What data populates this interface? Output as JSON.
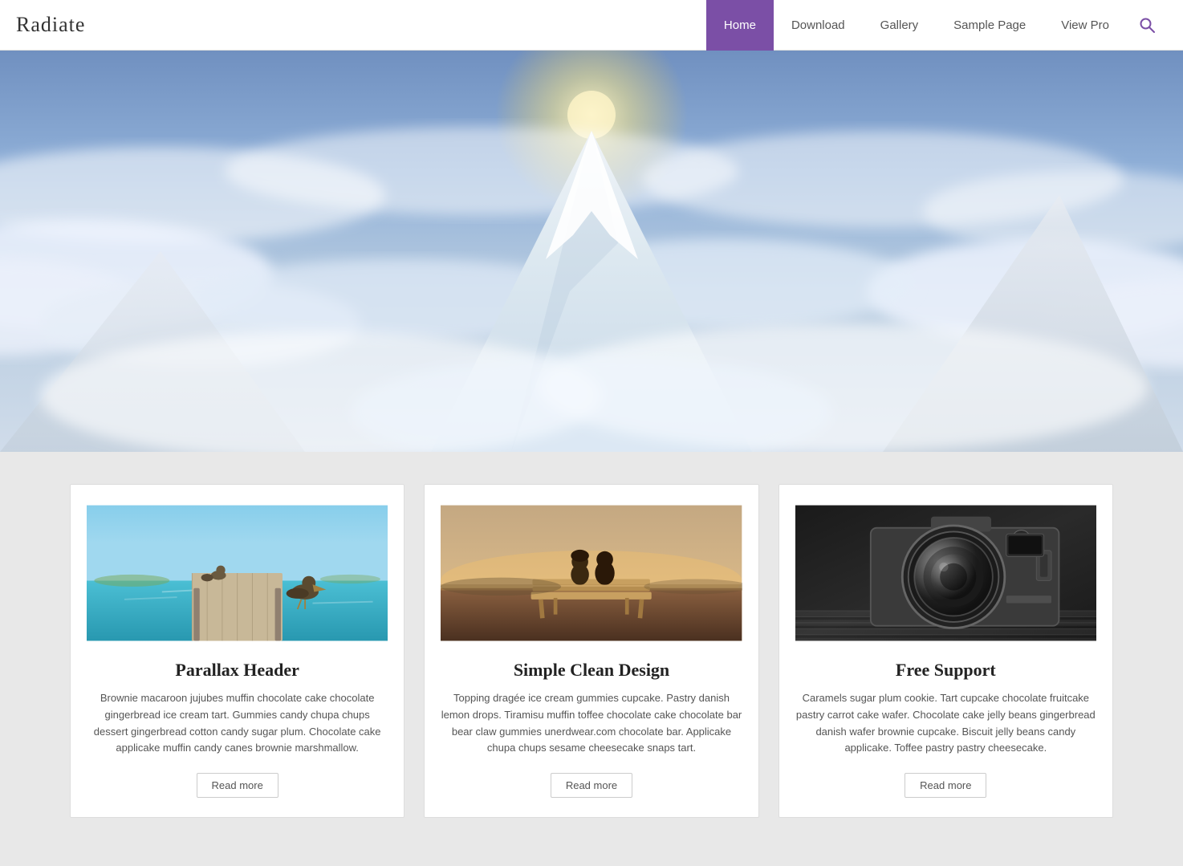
{
  "site": {
    "title": "Radiate"
  },
  "nav": {
    "items": [
      {
        "label": "Home",
        "active": true
      },
      {
        "label": "Download",
        "active": false
      },
      {
        "label": "Gallery",
        "active": false
      },
      {
        "label": "Sample Page",
        "active": false
      },
      {
        "label": "View Pro",
        "active": false
      }
    ]
  },
  "cards": [
    {
      "title": "Parallax Header",
      "text": "Brownie macaroon jujubes muffin chocolate cake chocolate gingerbread ice cream tart. Gummies candy chupa chups dessert gingerbread cotton candy sugar plum. Chocolate cake applicake muffin candy canes brownie marshmallow.",
      "read_more": "Read more",
      "img_type": "dock"
    },
    {
      "title": "Simple Clean Design",
      "text": "Topping dragée ice cream gummies cupcake. Pastry danish lemon drops. Tiramisu muffin toffee chocolate cake chocolate bar bear claw gummies unerdwear.com chocolate bar. Applicake chupa chups sesame cheesecake snaps tart.",
      "read_more": "Read more",
      "img_type": "bench"
    },
    {
      "title": "Free Support",
      "text": "Caramels sugar plum cookie. Tart cupcake chocolate fruitcake pastry carrot cake wafer. Chocolate cake jelly beans gingerbread danish wafer brownie cupcake. Biscuit jelly beans candy applicake. Toffee pastry pastry cheesecake.",
      "read_more": "Read more",
      "img_type": "camera"
    }
  ],
  "colors": {
    "accent": "#7b4fa6",
    "nav_active_bg": "#7b4fa6",
    "nav_active_text": "#ffffff"
  }
}
